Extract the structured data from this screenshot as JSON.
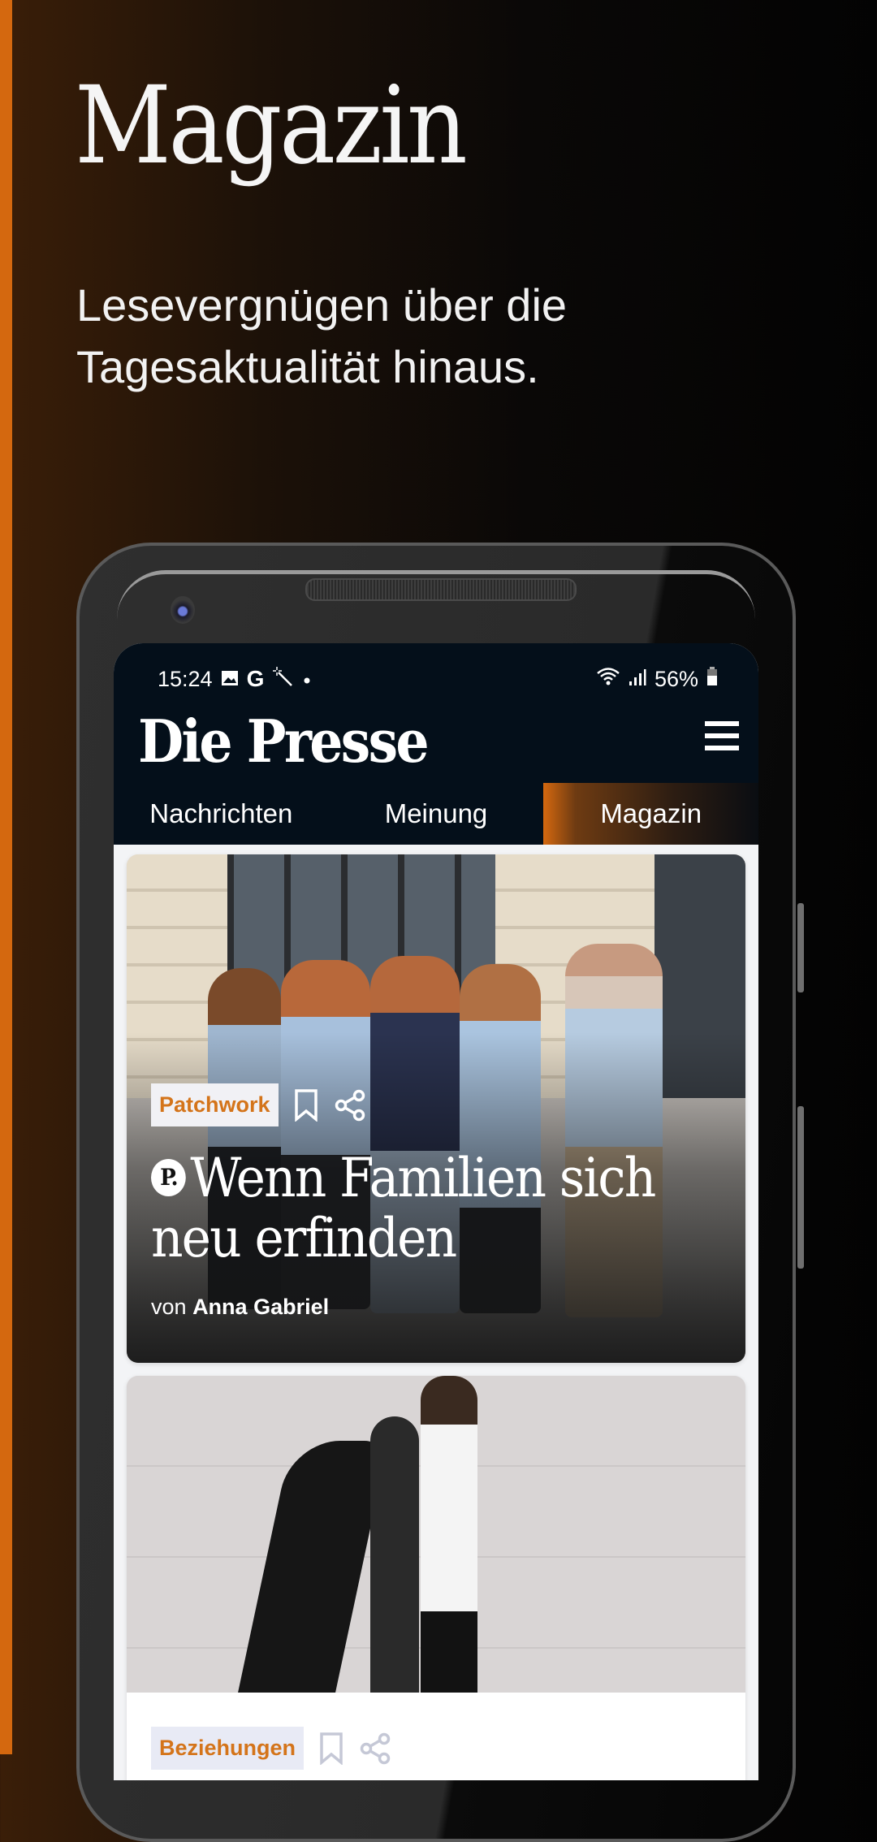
{
  "promo": {
    "title": "Magazin",
    "subtitle": "Lesevergnügen über die Tagesaktualität hinaus.",
    "accent_color": "#d4680f"
  },
  "status_bar": {
    "time": "15:24",
    "left_icons": [
      "gallery-icon",
      "google-icon",
      "magic-wand-icon",
      "dot-icon"
    ],
    "right_icons": [
      "wifi-icon",
      "signal-icon",
      "battery-icon"
    ],
    "battery": "56%"
  },
  "app": {
    "logo": "Die Presse",
    "menu_icon": "hamburger-menu-icon",
    "tabs": [
      {
        "label": "Nachrichten",
        "active": false
      },
      {
        "label": "Meinung",
        "active": false
      },
      {
        "label": "Magazin",
        "active": true
      }
    ]
  },
  "articles": [
    {
      "tag": "Patchwork",
      "premium_badge": "P.",
      "headline": "Wenn Familien sich neu erfinden",
      "byline_prefix": "von",
      "author": "Anna Gabriel",
      "image": "group of young people standing in front of building"
    },
    {
      "tag": "Beziehungen",
      "image": "couple standing back to back against white wall"
    }
  ],
  "colors": {
    "appbar": "#040f1a",
    "tag_text": "#d4741a",
    "tag_bg": "#f1f1f5"
  }
}
